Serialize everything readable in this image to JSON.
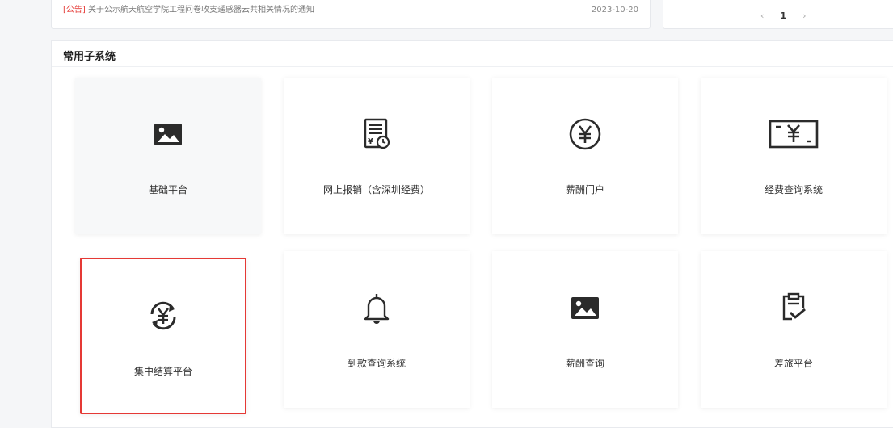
{
  "notice": {
    "tag": "[公告]",
    "text": "关于公示航天航空学院工程问卷收支遥感器云共相关情况的通知",
    "date": "2023-10-20"
  },
  "pager": {
    "prev": "‹",
    "page": "1",
    "next": "›"
  },
  "panel": {
    "title": "常用子系统",
    "tiles": [
      {
        "label": "基础平台",
        "icon": "image-icon"
      },
      {
        "label": "网上报销（含深圳经费）",
        "icon": "receipt-icon"
      },
      {
        "label": "薪酬门户",
        "icon": "yuan-circle-icon"
      },
      {
        "label": "经费查询系统",
        "icon": "yuan-screen-icon"
      },
      {
        "label": "集中结算平台",
        "icon": "yuan-refresh-icon"
      },
      {
        "label": "到款查询系统",
        "icon": "bell-icon"
      },
      {
        "label": "薪酬查询",
        "icon": "image-icon"
      },
      {
        "label": "差旅平台",
        "icon": "clipboard-check-icon"
      }
    ]
  }
}
